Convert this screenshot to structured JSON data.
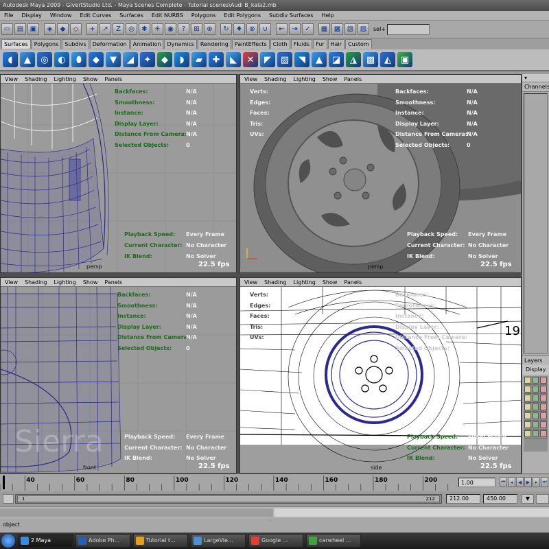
{
  "window": {
    "title": "Autodesk Maya 2009 - GivertStudio Ltd. - Maya Scenes Complete - Tutorial scenes\\Audi B_kala2.mb"
  },
  "menubar": [
    "File",
    "Display",
    "Window",
    "Edit Curves",
    "Surfaces",
    "Edit NURBS",
    "Polygons",
    "Edit Polygons",
    "Subdiv Surfaces",
    "Help"
  ],
  "statusline": {
    "sel_label": "sel+"
  },
  "shelf_tabs": [
    "Surfaces",
    "Polygons",
    "Subdivs",
    "Deformation",
    "Animation",
    "Dynamics",
    "Rendering",
    "PaintEffects",
    "Cloth",
    "Fluids",
    "Fur",
    "Hair",
    "Custom"
  ],
  "shelf_colors": [
    "#2a7de0",
    "#3b9be8",
    "#2f6fd0",
    "#1f8fe0",
    "#3aa0f0",
    "#2a7de0",
    "#3b9be8",
    "#4aa8f0",
    "#2f6fd0",
    "#28a040",
    "#1f8fe0",
    "#3aa0f0",
    "#2a7de0",
    "#4aa8f0",
    "#e04040",
    "#3b9be8",
    "#2f6fd0",
    "#1f8fe0",
    "#3aa0f0",
    "#2a7de0",
    "#28a040",
    "#3b9be8",
    "#2f6fd0",
    "#40b040"
  ],
  "viewport_menu": [
    "View",
    "Shading",
    "Lighting",
    "Show",
    "Panels"
  ],
  "hud_top_left": {
    "labels": [
      "Backfaces:",
      "Smoothness:",
      "Instance:",
      "Display Layer:",
      "Distance From Camera:",
      "Selected Objects:"
    ],
    "values": [
      "N/A",
      "N/A",
      "N/A",
      "N/A",
      "N/A",
      "0"
    ],
    "bottom_labels": [
      "Playback Speed:",
      "Current Character:",
      "IK Blend:"
    ],
    "bottom_values": [
      "Every Frame",
      "No Character",
      "No Solver"
    ],
    "fps": "22.5 fps",
    "camera": "persp"
  },
  "hud_top_right": {
    "labels": [
      "Verts:",
      "Edges:",
      "Faces:",
      "Tris:",
      "UVs:"
    ],
    "right_labels": [
      "Backfaces:",
      "Smoothness:",
      "Instance:",
      "Display Layer:",
      "Distance From Camera:",
      "Selected Objects:"
    ],
    "right_values": [
      "N/A",
      "N/A",
      "N/A",
      "N/A",
      "N/A",
      "0"
    ],
    "bottom_labels": [
      "Playback Speed:",
      "Current Character:",
      "IK Blend:"
    ],
    "bottom_values": [
      "Every Frame",
      "No Character",
      "No Solver"
    ],
    "fps": "22.5 fps",
    "camera": "persp"
  },
  "hud_bottom_left": {
    "labels": [
      "Backfaces:",
      "Smoothness:",
      "Instance:",
      "Display Layer:",
      "Distance From Camera:",
      "Selected Objects:"
    ],
    "values": [
      "N/A",
      "N/A",
      "N/A",
      "N/A",
      "N/A",
      "0"
    ],
    "bottom_labels": [
      "Playback Speed:",
      "Current Character:",
      "IK Blend:"
    ],
    "bottom_values": [
      "Every Frame",
      "No Character",
      "No Solver"
    ],
    "fps": "22.5 fps",
    "camera": "front"
  },
  "hud_bottom_right": {
    "labels": [
      "Verts:",
      "Edges:",
      "Faces:",
      "Tris:",
      "UVs:"
    ],
    "right_labels": [
      "Backfaces:",
      "Smoothness:",
      "Instance:",
      "Display Layer:",
      "Distance From Camera:",
      "Selected Objects:"
    ],
    "bottom_labels": [
      "Playback Speed:",
      "Current Character:",
      "IK Blend:"
    ],
    "bottom_values": [
      "Every Frame",
      "No Character",
      "No Solver"
    ],
    "fps": "22.5 fps",
    "camera": "side",
    "annotation": "19"
  },
  "channel_box": {
    "title": "Channels",
    "layers_title": "Layers",
    "layers_tab": "Display"
  },
  "timeline": {
    "ticks": [
      "40",
      "60",
      "80",
      "100",
      "120",
      "140",
      "160",
      "180",
      "200"
    ],
    "current_frame": "1.00",
    "range_start_inner": "1",
    "range_end_inner": "212",
    "range_end": "212.00",
    "max_end": "450.00"
  },
  "helpline": {
    "text": "object"
  },
  "taskbar": {
    "items": [
      {
        "label": "2 Maya",
        "color": "#3a8ad8"
      },
      {
        "label": "Adobe Ph...",
        "color": "#2a5fb0"
      },
      {
        "label": "Tutorial t...",
        "color": "#e0a020"
      },
      {
        "label": "LargeVie...",
        "color": "#5090d0"
      },
      {
        "label": "Google ...",
        "color": "#e04030"
      },
      {
        "label": "carwheel ...",
        "color": "#40a040"
      }
    ]
  }
}
